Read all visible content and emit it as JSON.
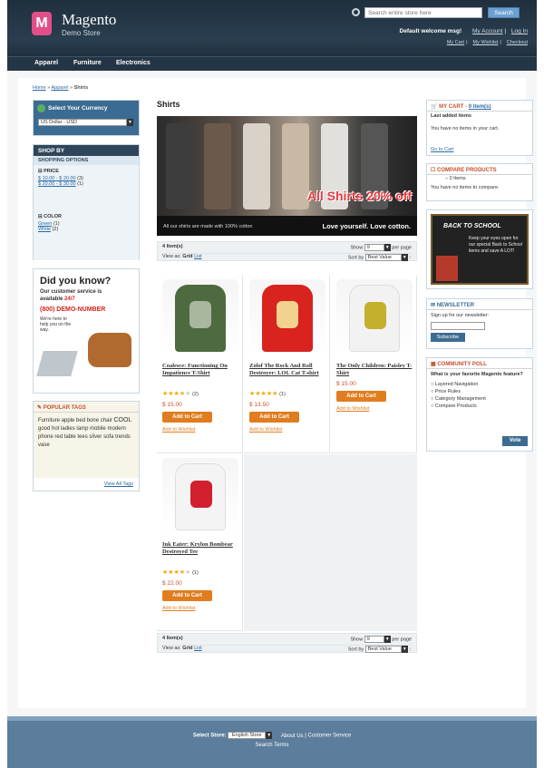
{
  "header": {
    "logo_letter": "M",
    "logo_name": "Magento",
    "logo_sub": "Demo Store",
    "search_placeholder": "Search entire store here",
    "search_button": "Search",
    "welcome": "Default welcome msg!",
    "account_links": [
      "My Account",
      "Log In"
    ],
    "top_links": [
      "My Cart",
      "My Wishlist",
      "Checkout"
    ]
  },
  "nav": [
    "Apparel",
    "Furniture",
    "Electronics"
  ],
  "breadcrumb": {
    "home": "Home",
    "parent": "Apparel",
    "current": "Shirts"
  },
  "currency": {
    "title": "Select Your Currency",
    "selected": "US Dollar - USD"
  },
  "shop_by": {
    "title": "SHOP BY",
    "options_label": "SHOPPING OPTIONS",
    "price_label": "PRICE",
    "price_items": [
      {
        "label": "$ 10.00 - $ 20.00",
        "count": "(3)"
      },
      {
        "label": "$ 20.00 - $ 30.00",
        "count": "(1)"
      }
    ],
    "color_label": "COLOR",
    "color_items": [
      {
        "label": "Green",
        "count": "(1)"
      },
      {
        "label": "White",
        "count": "(2)"
      }
    ]
  },
  "promo": {
    "title": "Did you know?",
    "line1": "Our customer service is",
    "line2": "available",
    "highlight": "24/7",
    "phone": "(800) DEMO-NUMBER",
    "help": "We're here to help you on the way."
  },
  "tags": {
    "title": "POPULAR TAGS",
    "items": [
      "Furniture",
      "apple",
      "bed",
      "bone",
      "chair",
      "COOL",
      "good",
      "hot",
      "ladies",
      "lamp",
      "mobile",
      "modern",
      "phone",
      "red",
      "table",
      "tees",
      "silver",
      "sofa",
      "trends",
      "vase"
    ],
    "view_all": "View All Tags"
  },
  "main": {
    "title": "Shirts",
    "banner": {
      "offer": "All Shirts 20% off",
      "note": "All our shirts are made with 100% cotton",
      "tagline": "Love yourself. Love cotton."
    }
  },
  "toolbar": {
    "items_label": "4 Item(s)",
    "show_label": "Show",
    "show_value": "9",
    "per_page": "per page",
    "view_as": "View as:",
    "grid": "Grid",
    "list": "List",
    "sort_label": "Sort by",
    "sort_value": "Best Value"
  },
  "products": [
    {
      "name": "Coalesce: Functioning On Impatience T-Shirt",
      "stars": 4,
      "reviews": "(2)",
      "price": "$ 15.00",
      "color": "#4d6b3f",
      "print": "#a9b7a0"
    },
    {
      "name": "Zolof The Rock And Roll Destroyer: LOL Cat T-shirt",
      "stars": 5,
      "reviews": "(1)",
      "price": "$ 13.50",
      "color": "#d8231f",
      "print": "#f3d28f"
    },
    {
      "name": "The Only Children: Paisley T-Shirt",
      "stars": 0,
      "reviews": "",
      "price": "$ 15.00",
      "color": "#f2f2f2",
      "print": "#c3b02c"
    },
    {
      "name": "Ink Eater: Krylon Bombear Destroyed Tee",
      "stars": 4,
      "reviews": "(1)",
      "price": "$ 22.00",
      "color": "#f4f4f4",
      "print": "#d2202f"
    }
  ],
  "product_actions": {
    "add_to_cart": "Add to Cart",
    "add_to_wishlist": "Add to Wishlist"
  },
  "cart": {
    "title": "MY CART",
    "items": "0 item(s)",
    "sub": "Last added items",
    "empty": "You have no items in your cart.",
    "link": "Go to Cart"
  },
  "compare": {
    "title": "COMPARE PRODUCTS",
    "count": "0 Items",
    "empty": "You have no items to compare."
  },
  "school": {
    "title": "BACK TO SCHOOL",
    "text": "Keep your eyes open for our special Back to School items and save A LOT!"
  },
  "newsletter": {
    "title": "NEWSLETTER",
    "label": "Sign up for our newsletter:",
    "button": "Subscribe"
  },
  "poll": {
    "title": "COMMUNITY POLL",
    "question": "What is your favorite Magento feature?",
    "options": [
      "Layered Navigation",
      "Price Rules",
      "Category Management",
      "Compare Products"
    ],
    "button": "Vote"
  },
  "footer": {
    "select_label": "Select Store:",
    "store": "English Store",
    "links": [
      "About Us",
      "Customer Service"
    ],
    "line2": "Search Terms"
  }
}
